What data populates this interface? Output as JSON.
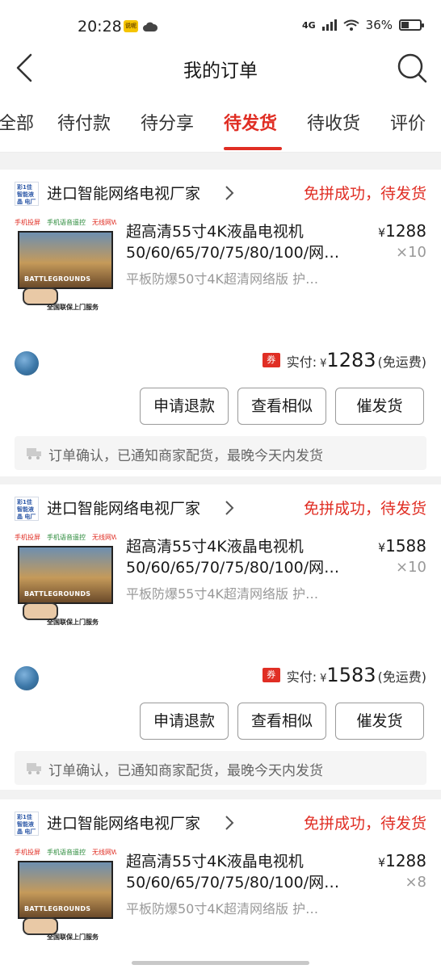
{
  "status_bar": {
    "time": "20:28",
    "app_badge": "说呢",
    "network": "4G",
    "battery": "36%",
    "battery_level": 0.36
  },
  "header": {
    "title": "我的订单"
  },
  "tabs": [
    {
      "label": "全部"
    },
    {
      "label": "待付款"
    },
    {
      "label": "待分享"
    },
    {
      "label": "待发货",
      "active": true
    },
    {
      "label": "待收货"
    },
    {
      "label": "评价"
    }
  ],
  "product_image": {
    "top_tags": [
      "手机投屏",
      "手机语音遥控",
      "无线网WiFi"
    ],
    "screen_text": "BATTLEGROUNDS",
    "bottom_text": "全国联保上门服务"
  },
  "shop_logo_text": "彩1佳 智能液晶 电厂家",
  "orders": [
    {
      "shop_name": "进口智能网络电视厂家",
      "status": "免拼成功，待发货",
      "title_line1": "超高清55寸4K液晶电视机",
      "title_line2": "50/60/65/70/75/80/100/网…",
      "spec": "平板防爆50寸4K超清网络版 护…",
      "currency": "¥",
      "price": "1288",
      "qty": "×10",
      "paid_label": "实付:",
      "paid_amount": "1283",
      "shipping_note": "(免运费)",
      "coupon": "券",
      "buttons": [
        "申请退款",
        "查看相似",
        "催发货"
      ],
      "notice": "订单确认，已通知商家配货，最晚今天内发货"
    },
    {
      "shop_name": "进口智能网络电视厂家",
      "status": "免拼成功，待发货",
      "title_line1": "超高清55寸4K液晶电视机",
      "title_line2": "50/60/65/70/75/80/100/网…",
      "spec": "平板防爆55寸4K超清网络版 护…",
      "currency": "¥",
      "price": "1588",
      "qty": "×10",
      "paid_label": "实付:",
      "paid_amount": "1583",
      "shipping_note": "(免运费)",
      "coupon": "券",
      "buttons": [
        "申请退款",
        "查看相似",
        "催发货"
      ],
      "notice": "订单确认，已通知商家配货，最晚今天内发货"
    },
    {
      "shop_name": "进口智能网络电视厂家",
      "status": "免拼成功，待发货",
      "title_line1": "超高清55寸4K液晶电视机",
      "title_line2": "50/60/65/70/75/80/100/网…",
      "spec": "平板防爆50寸4K超清网络版 护…",
      "currency": "¥",
      "price": "1288",
      "qty": "×8"
    }
  ],
  "colors": {
    "accent": "#e02e24",
    "muted_text": "#999999",
    "background": "#f2f2f2"
  }
}
